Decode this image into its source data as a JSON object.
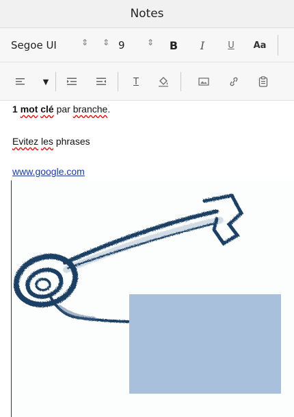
{
  "window": {
    "title": "Notes"
  },
  "format_bar": {
    "font_name": "Segoe UI",
    "font_size": "9",
    "bold_label": "B",
    "italic_label": "I",
    "underline_label": "U",
    "case_label": "Aa"
  },
  "paragraph_bar": {
    "clear_format_label": "T"
  },
  "content": {
    "line1": {
      "bold_num": "1",
      "word_mot": "mot",
      "word_cle": "clé",
      "word_par": "par",
      "word_branche": "branche",
      "period": "."
    },
    "line2": {
      "word_evitez": "Evitez",
      "word_les": "les",
      "word_phrases": "phrases"
    },
    "link_text": "www.google.com"
  },
  "colors": {
    "link": "#1a3d9a",
    "tag": "#a9c0dd",
    "key": "#1d3f63"
  }
}
